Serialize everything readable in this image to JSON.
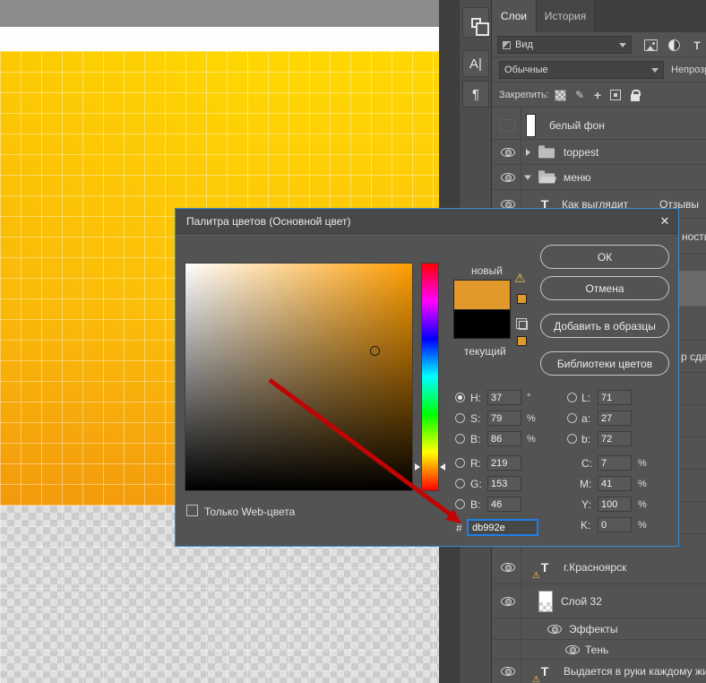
{
  "colors": {
    "accent_blue": "#1d80e8",
    "arrow_red": "#c00404",
    "picker_new": "#e2992c",
    "picker_current": "#000000",
    "picker_hue": "#ff9d00"
  },
  "toolstrip": {
    "buttons": [
      {
        "name": "clone-panel"
      },
      {
        "name": "character-panel",
        "glyph": "А|"
      },
      {
        "name": "paragraph-panel",
        "glyph": "¶"
      }
    ]
  },
  "panel": {
    "tabs": [
      {
        "label": "Слои"
      },
      {
        "label": "История"
      }
    ],
    "filter_value": "Вид",
    "blend_value": "Обычные",
    "opacity_label": "Непрозр",
    "lock_label": "Закрепить:",
    "layers": [
      {
        "name": "белый фон"
      },
      {
        "name": "toppest"
      },
      {
        "name": "меню"
      },
      {
        "name": "Как выглядит",
        "right_text": "Отзывы"
      },
      {
        "name": "ность"
      },
      {
        "name": "р сдае"
      },
      {
        "name": "г.Красноярск"
      },
      {
        "name": "Слой 32"
      },
      {
        "name": "Эффекты"
      },
      {
        "name": "Тень"
      },
      {
        "name": "Выдается в руки каждому жите"
      }
    ]
  },
  "picker": {
    "title": "Палитра цветов (Основной цвет)",
    "close_glyph": "✕",
    "new_label": "новый",
    "current_label": "текущий",
    "buttons": [
      {
        "label": "ОК"
      },
      {
        "label": "Отмена"
      },
      {
        "label": "Добавить в образцы"
      },
      {
        "label": "Библиотеки цветов"
      }
    ],
    "left_fields": [
      {
        "label": "H:",
        "value": "37",
        "unit": "°"
      },
      {
        "label": "S:",
        "value": "79",
        "unit": "%"
      },
      {
        "label": "B:",
        "value": "86",
        "unit": "%"
      },
      {
        "label": "R:",
        "value": "219",
        "unit": ""
      },
      {
        "label": "G:",
        "value": "153",
        "unit": ""
      },
      {
        "label": "B:",
        "value": "46",
        "unit": ""
      }
    ],
    "right_fields": [
      {
        "label": "L:",
        "value": "71",
        "unit": ""
      },
      {
        "label": "a:",
        "value": "27",
        "unit": ""
      },
      {
        "label": "b:",
        "value": "72",
        "unit": ""
      },
      {
        "label": "C:",
        "value": "7",
        "unit": "%"
      },
      {
        "label": "M:",
        "value": "41",
        "unit": "%"
      },
      {
        "label": "Y:",
        "value": "100",
        "unit": "%"
      },
      {
        "label": "K:",
        "value": "0",
        "unit": "%"
      }
    ],
    "hex_label": "#",
    "hex_value": "db992e",
    "web_only_label": "Только Web-цвета"
  }
}
